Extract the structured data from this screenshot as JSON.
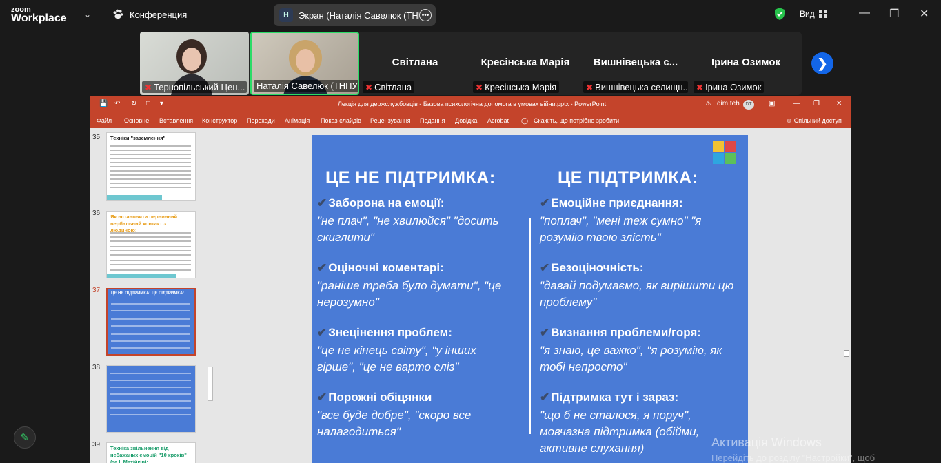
{
  "zoom": {
    "brand_small": "zoom",
    "brand_big": "Workplace",
    "meeting_label": "Конференция",
    "share_avatar": "Н",
    "share_label": "Экран (Наталія Савелюк (ТНПУ",
    "view_label": "Вид",
    "icons": [
      "chevron-down-icon",
      "paw-icon",
      "more-icon",
      "shield-icon",
      "grid-icon",
      "minimize-icon",
      "restore-icon",
      "close-icon",
      "next-page-icon",
      "pen-icon"
    ]
  },
  "participants": [
    {
      "name": "Тернопільський Цен...",
      "muted": true,
      "video": true
    },
    {
      "name": "Наталія Савелюк (ТНПУ)",
      "muted": false,
      "video": true,
      "active": true
    },
    {
      "big": "Світлана",
      "name": "Світлана",
      "muted": true
    },
    {
      "big": "Кресінська Марія",
      "name": "Кресінська Марія",
      "muted": true
    },
    {
      "big": "Вишнівецька  с...",
      "name": "Вишнівецька селищн...",
      "muted": true
    },
    {
      "big": "Ірина Озимок",
      "name": "Ірина Озимок",
      "muted": true
    }
  ],
  "ppt": {
    "title": "Лекція для держслужбовців - Базова психологічна допомога в умовах війни.pptx  -  PowerPoint",
    "warning": "dim teh",
    "user_initials": "DT",
    "tabs": [
      "Файл",
      "Основне",
      "Вставлення",
      "Конструктор",
      "Переходи",
      "Анімація",
      "Показ слайдів",
      "Рецензування",
      "Подання",
      "Довідка",
      "Acrobat"
    ],
    "tell_me": "Скажіть, що потрібно зробити",
    "share": "Спільний доступ",
    "thumbs": [
      {
        "num": "35",
        "title": "Техніки \"заземлення\""
      },
      {
        "num": "36",
        "title": "Як встановити первинний вербальний контакт з людиною:"
      },
      {
        "num": "37",
        "title": "ЦЕ НЕ ПІДТРИМКА:   ЦЕ ПІДТРИМКА:",
        "selected": true
      },
      {
        "num": "38",
        "title": ""
      },
      {
        "num": "39",
        "title": "Техніка звільнення від небажаних емоцій \"10 кроків\" (за І. Матійків):"
      }
    ]
  },
  "slide": {
    "left_header": "ЦЕ НЕ ПІДТРИМКА:",
    "right_header": "ЦЕ ПІДТРИМКА:",
    "left_items": [
      {
        "head": "Заборона на емоції:",
        "quote": "\"не плач\", \"не хвилюйся\" \"досить скиглити\""
      },
      {
        "head": "Оціночні коментарі:",
        "quote": "\"раніше треба було думати\", \"це нерозумно\""
      },
      {
        "head": "Знецінення проблем:",
        "quote": "\"це не кінець світу\", \"у інших гірше\", \"це не варто сліз\""
      },
      {
        "head": "Порожні обіцянки",
        "quote": "\"все буде добре\", \"скоро все налагодиться\""
      }
    ],
    "right_items": [
      {
        "head": "Емоційне приєднання:",
        "quote": "\"поплач\", \"мені теж сумно\" \"я розумію твою злість\""
      },
      {
        "head": "Безоціночність:",
        "quote": "\"давай подумаємо, як вирішити цю проблему\""
      },
      {
        "head": "Визнання проблеми/горя:",
        "quote": "\"я знаю, це важко\", \"я розумію, як тобі непросто\""
      },
      {
        "head": "Підтримка тут і зараз:",
        "quote": "\"що б не сталося, я поруч\", мовчазна підтримка (обійми, активне слухання)"
      }
    ]
  },
  "os": {
    "activation_title": "Активація Windows",
    "activation_sub": "Перейдіть до розділу \"Настройки\", щоб"
  }
}
